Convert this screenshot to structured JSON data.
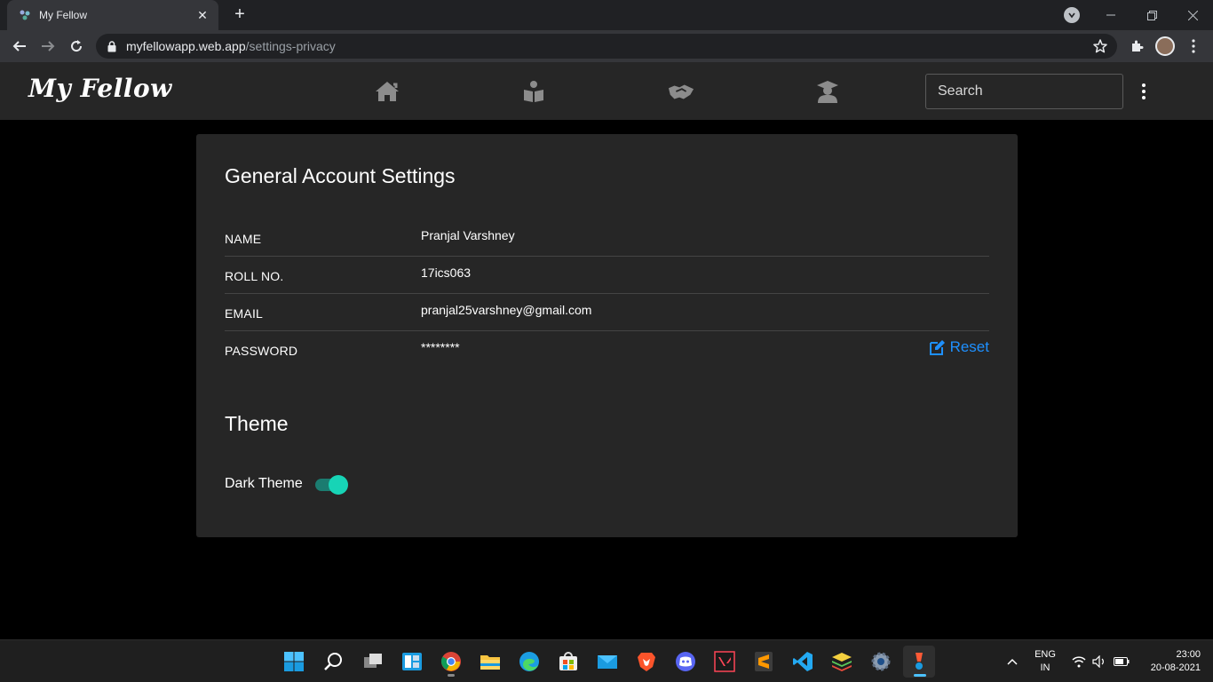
{
  "browser": {
    "tab_title": "My Fellow",
    "url_host": "myfellowapp.web.app",
    "url_path": "/settings-privacy"
  },
  "app": {
    "logo": "My Fellow",
    "nav_icons": [
      "home-icon",
      "book-reader-icon",
      "handshake-icon",
      "graduate-icon"
    ],
    "search_placeholder": "Search"
  },
  "settings": {
    "title": "General Account Settings",
    "rows": [
      {
        "label": "NAME",
        "value": "Pranjal Varshney"
      },
      {
        "label": "ROLL NO.",
        "value": "17ics063"
      },
      {
        "label": "EMAIL",
        "value": "pranjal25varshney@gmail.com"
      },
      {
        "label": "PASSWORD",
        "value": "********",
        "action": "Reset"
      }
    ],
    "theme_title": "Theme",
    "dark_theme_label": "Dark Theme",
    "dark_theme_enabled": true,
    "accent_color": "#17d4b6",
    "link_color": "#1e90ff"
  },
  "taskbar": {
    "apps": [
      "windows-start",
      "search",
      "task-view",
      "widgets",
      "chrome",
      "file-explorer",
      "edge",
      "microsoft-store",
      "mail",
      "brave",
      "discord",
      "valorant",
      "sublime-text",
      "vs-code",
      "bluestacks",
      "settings",
      "active-app"
    ],
    "lang_line1": "ENG",
    "lang_line2": "IN",
    "time": "23:00",
    "date": "20-08-2021"
  }
}
